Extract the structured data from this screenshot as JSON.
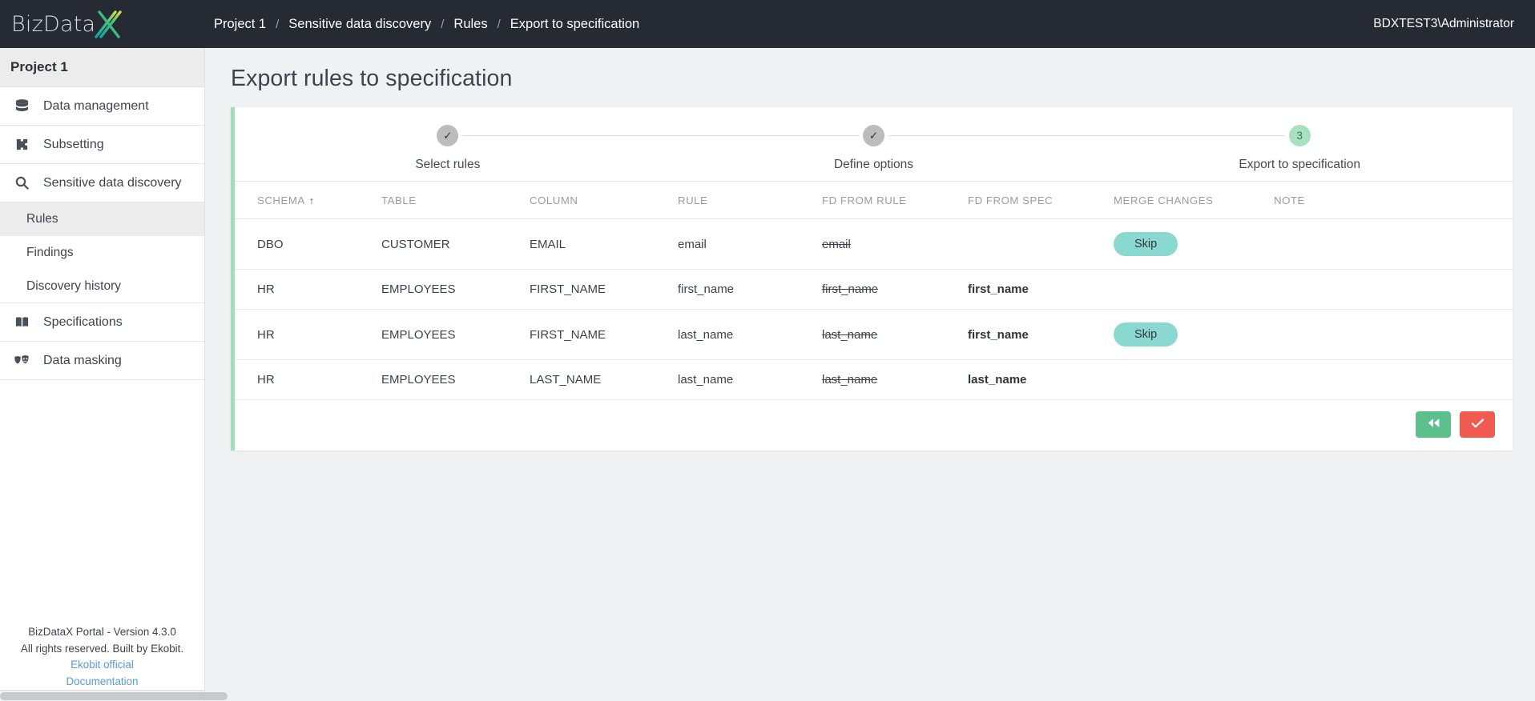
{
  "header": {
    "logo_text": "BizData",
    "logo_mark": "X",
    "breadcrumb": [
      {
        "label": "Project 1",
        "sep": "/"
      },
      {
        "label": "Sensitive data discovery",
        "sep": "/"
      },
      {
        "label": "Rules",
        "sep": "/"
      },
      {
        "label": "Export to specification",
        "sep": ""
      }
    ],
    "user": "BDXTEST3\\Administrator",
    "bg_color": "#262b33"
  },
  "sidebar": {
    "project_title": "Project 1",
    "items": [
      {
        "label": "Data management",
        "icon": "database-icon"
      },
      {
        "label": "Subsetting",
        "icon": "puzzle-icon"
      },
      {
        "label": "Sensitive data discovery",
        "icon": "search-icon"
      }
    ],
    "subitems": [
      {
        "label": "Rules",
        "active": true
      },
      {
        "label": "Findings",
        "active": false
      },
      {
        "label": "Discovery history",
        "active": false
      }
    ],
    "items_after": [
      {
        "label": "Specifications",
        "icon": "book-icon"
      },
      {
        "label": "Data masking",
        "icon": "masks-icon"
      }
    ],
    "footer": {
      "line1": "BizDataX Portal - Version 4.3.0",
      "line2": "All rights reserved. Built by Ekobit.",
      "link1": "Ekobit official",
      "link2": "Documentation"
    }
  },
  "main": {
    "page_title": "Export rules to specification",
    "accent_color": "#a4dcbb",
    "stepper": [
      {
        "label": "Select rules",
        "state": "done",
        "marker": "✓"
      },
      {
        "label": "Define options",
        "state": "done",
        "marker": "✓"
      },
      {
        "label": "Export to specification",
        "state": "current",
        "marker": "3"
      }
    ],
    "table": {
      "columns": [
        {
          "label": "SCHEMA",
          "sorted": true,
          "sort_dir": "↑"
        },
        {
          "label": "TABLE",
          "sorted": false,
          "sort_dir": ""
        },
        {
          "label": "COLUMN",
          "sorted": false,
          "sort_dir": ""
        },
        {
          "label": "RULE",
          "sorted": false,
          "sort_dir": ""
        },
        {
          "label": "FD FROM RULE",
          "sorted": false,
          "sort_dir": ""
        },
        {
          "label": "FD FROM SPEC",
          "sorted": false,
          "sort_dir": ""
        },
        {
          "label": "MERGE CHANGES",
          "sorted": false,
          "sort_dir": ""
        },
        {
          "label": "NOTE",
          "sorted": false,
          "sort_dir": ""
        }
      ],
      "rows": [
        {
          "schema": "DBO",
          "table": "CUSTOMER",
          "column": "EMAIL",
          "rule": "email",
          "fd_from_rule": "email",
          "fd_from_spec": "",
          "merge_changes": "Skip",
          "has_skip": true,
          "note": ""
        },
        {
          "schema": "HR",
          "table": "EMPLOYEES",
          "column": "FIRST_NAME",
          "rule": "first_name",
          "fd_from_rule": "first_name",
          "fd_from_spec": "first_name",
          "merge_changes": "",
          "has_skip": false,
          "note": ""
        },
        {
          "schema": "HR",
          "table": "EMPLOYEES",
          "column": "FIRST_NAME",
          "rule": "last_name",
          "fd_from_rule": "last_name",
          "fd_from_spec": "first_name",
          "merge_changes": "Skip",
          "has_skip": true,
          "note": ""
        },
        {
          "schema": "HR",
          "table": "EMPLOYEES",
          "column": "LAST_NAME",
          "rule": "last_name",
          "fd_from_rule": "last_name",
          "fd_from_spec": "last_name",
          "merge_changes": "",
          "has_skip": false,
          "note": ""
        }
      ]
    },
    "actions": {
      "back": {
        "icon": "rewind-icon",
        "glyph": "◀◀",
        "color": "#5cc08c"
      },
      "confirm": {
        "icon": "check-icon",
        "glyph": "✓",
        "color": "#ef5a51"
      }
    }
  }
}
